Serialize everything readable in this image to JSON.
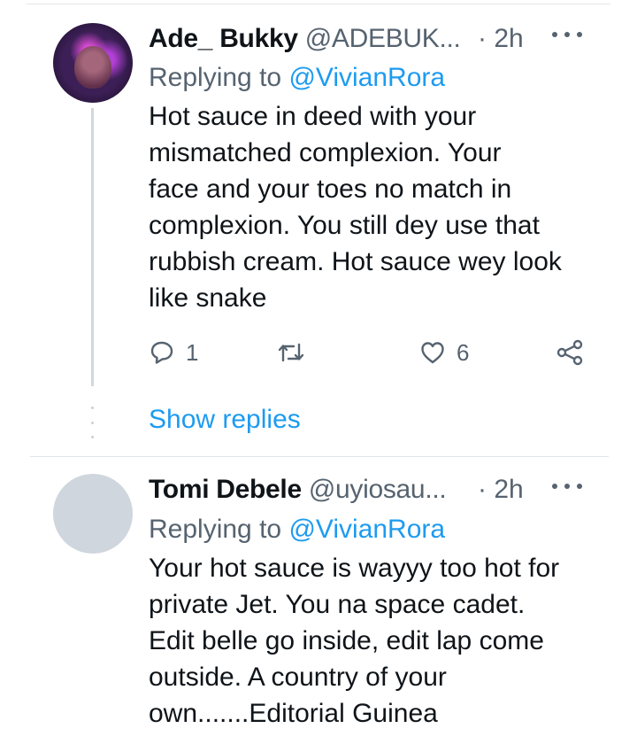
{
  "tweets": [
    {
      "author_name": "Ade_ Bukky",
      "author_handle": "@ADEBUK...",
      "time": "· 2h",
      "replying_prefix": "Replying to ",
      "replying_to": "@VivianRora",
      "text_lines": [
        "Hot sauce in deed with your",
        "mismatched complexion. Your",
        "face and your toes no match in",
        "complexion. You still dey use that",
        "rubbish cream. Hot sauce wey look",
        "like snake"
      ],
      "reply_count": "1",
      "like_count": "6",
      "show_replies": "Show replies",
      "avatar": "profile-photo"
    },
    {
      "author_name": "Tomi Debele",
      "author_handle": "@uyiosau...",
      "time": "· 2h",
      "replying_prefix": "Replying to ",
      "replying_to": "@VivianRora",
      "text_lines": [
        "Your hot sauce is wayyy too hot for",
        "private Jet. You na space cadet.",
        "Edit belle go inside, edit lap come",
        "outside. A country of your",
        "own.......Editorial Guinea"
      ],
      "avatar": "default-avatar"
    }
  ],
  "icons": {
    "reply": "speech-bubble-icon",
    "retweet": "retweet-icon",
    "like": "heart-icon",
    "share": "share-icon",
    "more": "more-dots-icon"
  },
  "colors": {
    "accent": "#1d9bf0",
    "secondary_text": "#566370",
    "primary_text": "#0f1419",
    "divider": "#e1e6ea",
    "default_avatar": "#cfd6dd"
  }
}
